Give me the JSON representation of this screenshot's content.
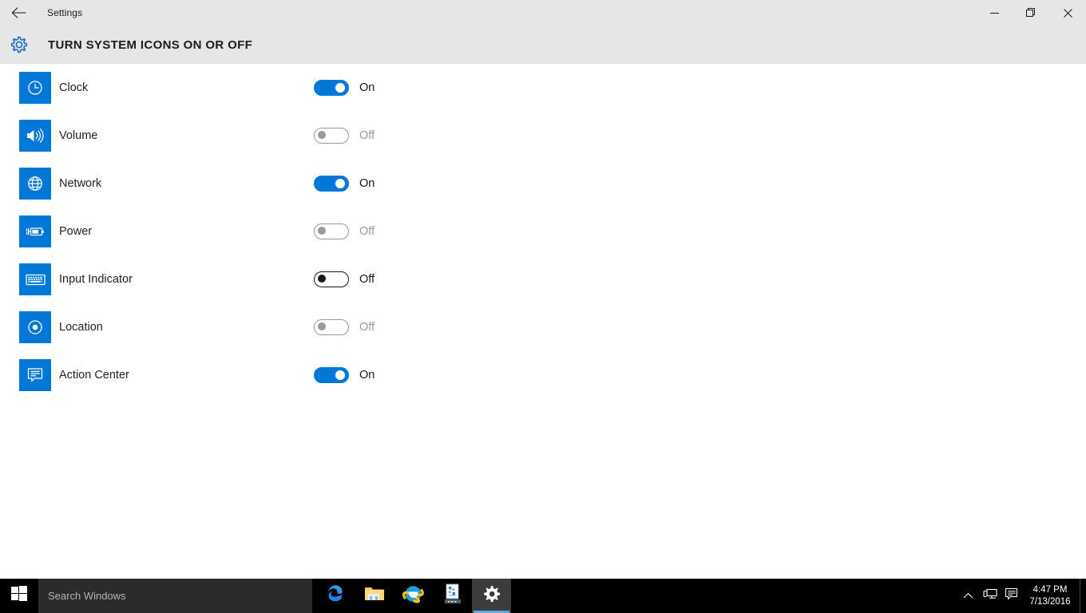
{
  "window": {
    "title": "Settings",
    "back_icon": "back-arrow-icon",
    "minimize_label": "Minimize",
    "maximize_label": "Restore",
    "close_label": "Close"
  },
  "header": {
    "icon": "gear-icon",
    "title": "TURN SYSTEM ICONS ON OR OFF"
  },
  "colors": {
    "accent": "#0078D7",
    "header_bg": "#E6E6E6",
    "content_bg": "#FFFFFF",
    "taskbar_bg": "#000000",
    "search_bg": "#2B2B2B",
    "toggle_off_border": "#9A9A9A",
    "taskbar_underline": "#5AA8E0"
  },
  "rows": [
    {
      "label": "Clock",
      "icon": "clock-icon",
      "state": "On",
      "on": true,
      "focused": false
    },
    {
      "label": "Volume",
      "icon": "volume-icon",
      "state": "Off",
      "on": false,
      "focused": false
    },
    {
      "label": "Network",
      "icon": "globe-icon",
      "state": "On",
      "on": true,
      "focused": false
    },
    {
      "label": "Power",
      "icon": "battery-icon",
      "state": "Off",
      "on": false,
      "focused": false
    },
    {
      "label": "Input Indicator",
      "icon": "keyboard-icon",
      "state": "Off",
      "on": false,
      "focused": true
    },
    {
      "label": "Location",
      "icon": "location-target-icon",
      "state": "Off",
      "on": false,
      "focused": false
    },
    {
      "label": "Action Center",
      "icon": "speech-bubble-icon",
      "state": "On",
      "on": true,
      "focused": false
    }
  ],
  "taskbar": {
    "start_label": "Start",
    "search": {
      "placeholder": "Search Windows",
      "value": ""
    },
    "apps": [
      {
        "name": "microsoft-edge",
        "icon": "edge-icon",
        "active": false,
        "running": false
      },
      {
        "name": "file-explorer",
        "icon": "folder-icon",
        "active": false,
        "running": false
      },
      {
        "name": "internet-explorer",
        "icon": "ie-icon",
        "active": false,
        "running": true
      },
      {
        "name": "document-app",
        "icon": "document-icon",
        "active": false,
        "running": false
      },
      {
        "name": "settings",
        "icon": "gear-icon",
        "active": true,
        "running": true
      }
    ],
    "tray": {
      "show_hidden_icon": "chevron-up-icon",
      "network_icon": "network-monitor-icon",
      "action_center_icon": "speech-bubble-icon",
      "time": "4:47 PM",
      "date": "7/13/2016"
    }
  }
}
